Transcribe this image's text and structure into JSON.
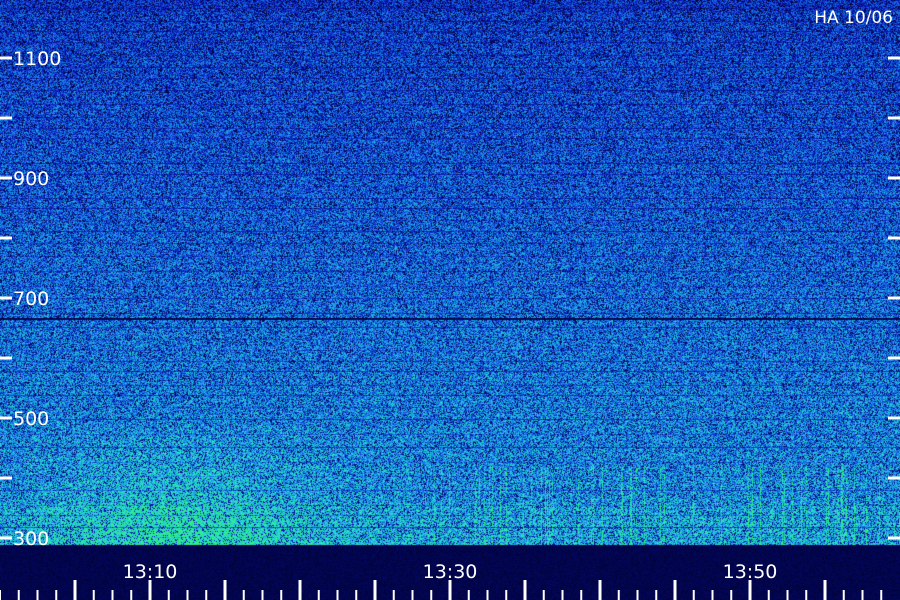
{
  "chart_data": {
    "type": "heatmap",
    "title": "HA 10/06",
    "y_axis": {
      "ticks": [
        300,
        400,
        500,
        600,
        700,
        800,
        900,
        1000,
        1100,
        1200
      ],
      "tick_labels": [
        "300",
        "",
        "500",
        "",
        "700",
        "",
        "900",
        "",
        "1100",
        ""
      ],
      "range": [
        300,
        1180
      ]
    },
    "x_axis": {
      "ticks": [
        "13:05",
        "13:10",
        "13:15",
        "13:20",
        "13:25",
        "13:30",
        "13:35",
        "13:40",
        "13:45",
        "13:50",
        "13:55"
      ],
      "tick_labels": [
        "",
        "13:10",
        "",
        "",
        "",
        "13:30",
        "",
        "",
        "",
        "13:50",
        ""
      ],
      "minor_tick_minutes": 1.25,
      "range": [
        "13:02",
        "13:58"
      ]
    },
    "colormap": [
      "#00002a",
      "#0a14b4",
      "#1450dc",
      "#1ea0e6",
      "#2ce8c8",
      "#30f070"
    ],
    "intensity_notes": {
      "low_frequency_enhancement_start": "13:05",
      "low_frequency_enhancement_peak": "13:12"
    }
  }
}
